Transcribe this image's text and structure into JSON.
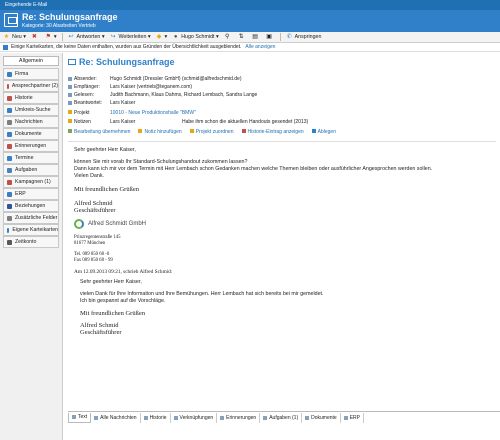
{
  "window": {
    "title": "Eingehende E-Mail"
  },
  "header": {
    "title": "Re: Schulungsanfrage",
    "subtitle": "Kategorie: 30 Abarbeiten Vertrieb"
  },
  "toolbar": {
    "new": "Neu",
    "reply": "Antworten",
    "forward": "Weiterleiten",
    "user": "Hugo Schmidt",
    "call": "Anspringen"
  },
  "info": {
    "text": "Einige Karteikarten, die keine Daten enthalten, wurden aus Gründen der Übersichtlichkeit ausgeblendet.",
    "link": "Alle anzeigen"
  },
  "sidebar": {
    "tab": "Allgemein",
    "items": [
      {
        "label": "Firma",
        "color": "#3a7fc4"
      },
      {
        "label": "Ansprechpartner (2)",
        "color": "#c0504d"
      },
      {
        "label": "Historie",
        "color": "#c0504d"
      },
      {
        "label": "Umkreis-Suche",
        "color": "#3a7fc4"
      },
      {
        "label": "Nachrichten",
        "color": "#7f7f7f"
      },
      {
        "label": "Dokumente",
        "color": "#3a7fc4"
      },
      {
        "label": "Erinnerungen",
        "color": "#c0504d"
      },
      {
        "label": "Termine",
        "color": "#3a7fc4"
      },
      {
        "label": "Aufgaben",
        "color": "#4f81bd"
      },
      {
        "label": "Kampagnen (1)",
        "color": "#c0504d"
      },
      {
        "label": "ERP",
        "color": "#3a7fc4"
      },
      {
        "label": "Beziehungen",
        "color": "#2f5597"
      },
      {
        "label": "Zusätzliche Felder",
        "color": "#7f7f7f"
      },
      {
        "label": "Eigene Karteikarten",
        "color": "#3a7fc4"
      },
      {
        "label": "Zeitkonto",
        "color": "#595959"
      }
    ]
  },
  "mail": {
    "title": "Re: Schulungsanfrage",
    "from_label": "Absender:",
    "from": "Hugo Schmidt (Dressler GmbH) (schmid@alfredschmid.de)",
    "to_label": "Empfänger:",
    "to": "Lars Kaiser (vertrieb@teganem.com)",
    "read_label": "Gelesen:",
    "read": "Judith Bachmann, Klaus Dahms, Richard Lembach, Sandra Lange",
    "answered_label": "Beantwortet:",
    "answered": "Lars Kaiser",
    "project_label": "Projekt",
    "project": "10010 - Neue Produktionshalle \"BMW\"",
    "notes_label": "Notizen",
    "notes_user": "Lars Kaiser",
    "notes_text": "Habe ihm schon die aktuellen Handouts gesendet (2013)"
  },
  "actions": [
    "Bearbeitung übernehmen",
    "Notiz hinzufügen",
    "Projekt zuordnen",
    "Historie-Eintrag anzeigen",
    "Ablegen"
  ],
  "body": {
    "greeting": "Sehr geehrter Herr Kaiser,",
    "l1": "können Sie mir vorab Ihr Standard-Schulungshandout zukommen lassen?",
    "l2": "Dann kann ich mir vor dem Termin mit Herr Lembach schon Gedanken machen welche Themen bleiben oder ausführlicher Angesprochen werden sollen.",
    "l3": "Vielen Dank.",
    "regards": "Mit freundlichen Grüßen",
    "name": "Alfred Schmid",
    "role": "Geschäftsführer",
    "logo": "Alfred Schmidt GmbH",
    "street": "Prinzregentenstraße 145",
    "city": "81677 München",
    "tel": "Tel. 089 850 68 -0",
    "fax": "Fax 089 850 68 - 99",
    "quote_head": "Am 12.09.2013 09:21, schrieb Alfred Schmid:",
    "q_greeting": "Sehr geehrter Herr Kaiser,",
    "q1": "vielen Dank für Ihre Information und Ihre Bemühungen. Herr Lembach hat sich bereits bei mir gemeldet.",
    "q2": "Ich bin gespannt auf die Vorschläge.",
    "q_regards": "Mit freundlichen Grüßen",
    "q_name": "Alfred Schmid",
    "q_role": "Geschäftsführer"
  },
  "tabs": [
    "Text",
    "Alle Nachrichten",
    "Historie",
    "Verknüpfungen",
    "Erinnerungen",
    "Aufgaben (1)",
    "Dokumente",
    "ERP"
  ]
}
